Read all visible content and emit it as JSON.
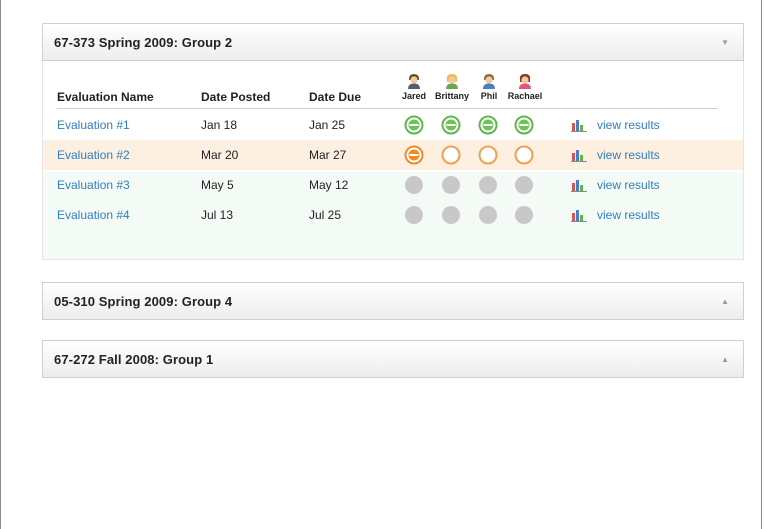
{
  "panels": [
    {
      "title": "67-373 Spring 2009: Group 2",
      "expanded": true,
      "columns": {
        "name": "Evaluation Name",
        "posted": "Date Posted",
        "due": "Date Due"
      },
      "members": [
        "Jared",
        "Brittany",
        "Phil",
        "Rachael"
      ],
      "rows": [
        {
          "name": "Evaluation #1",
          "posted": "Jan 18",
          "due": "Jan 25",
          "status": [
            "complete",
            "complete",
            "complete",
            "complete"
          ],
          "results": "view results"
        },
        {
          "name": "Evaluation #2",
          "posted": "Mar 20",
          "due": "Mar 27",
          "status": [
            "in-progress",
            "pending",
            "pending",
            "pending"
          ],
          "results": "view results"
        },
        {
          "name": "Evaluation #3",
          "posted": "May 5",
          "due": "May 12",
          "status": [
            "inactive",
            "inactive",
            "inactive",
            "inactive"
          ],
          "results": "view results"
        },
        {
          "name": "Evaluation #4",
          "posted": "Jul 13",
          "due": "Jul 25",
          "status": [
            "inactive",
            "inactive",
            "inactive",
            "inactive"
          ],
          "results": "view results"
        }
      ]
    },
    {
      "title": "05-310 Spring 2009: Group 4",
      "expanded": false
    },
    {
      "title": "67-272 Fall 2008: Group 1",
      "expanded": false
    }
  ],
  "icons": {
    "expanded_arrow": "▼",
    "collapsed_arrow": "▲",
    "results": "bar-chart-icon",
    "member": "user-avatar-icon"
  },
  "colors": {
    "complete": "#5cb84a",
    "in_progress": "#f08a24",
    "pending": "#f0a050",
    "inactive": "#c8c8c8",
    "link": "#2f7fc1",
    "highlight_row": "#fdf0e0"
  }
}
